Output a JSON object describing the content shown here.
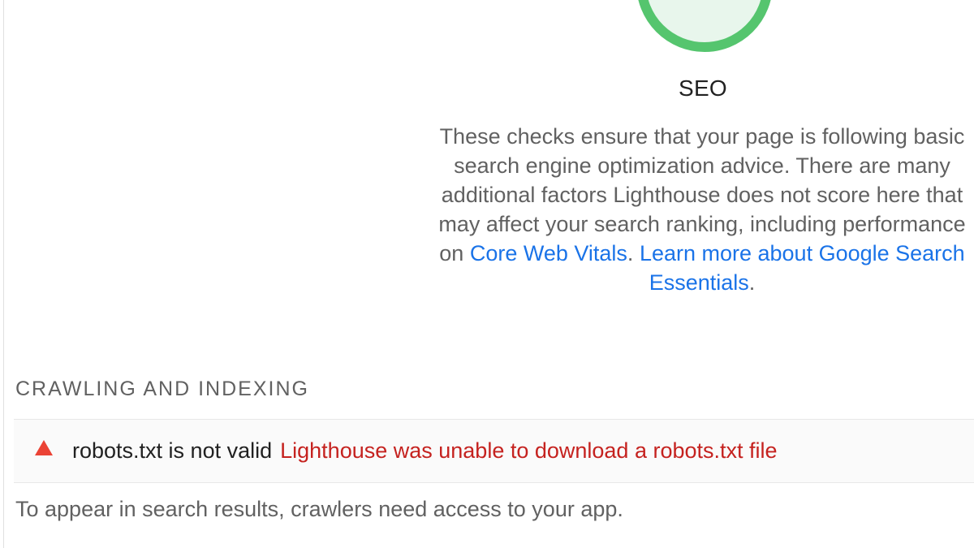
{
  "category": {
    "title": "SEO",
    "score_color": "#0cce6b",
    "score_ring_color": "#55c56e",
    "score_fill_color": "#e8f6ec",
    "description": {
      "line1": "These checks ensure that your page is following basic",
      "line2": "search engine optimization advice. There are many",
      "line3": "additional factors Lighthouse does not score here that",
      "line4": "may affect your search ranking, including performance",
      "line5_prefix": "on ",
      "core_web_vitals_link": "Core Web Vitals",
      "line5_separator": ". ",
      "learn_more_link_part1": "Learn more about Google Search",
      "learn_more_link_part2": "Essentials",
      "line6_suffix": "."
    }
  },
  "group": {
    "heading": "CRAWLING AND INDEXING"
  },
  "audit": {
    "status": "fail",
    "status_icon": "fail-triangle-icon",
    "status_color": "#eb4335",
    "title": "robots.txt is not valid",
    "explanation": "Lighthouse was unable to download a robots.txt file",
    "explanation_color": "#c5221f",
    "description": "To appear in search results, crawlers need access to your app."
  },
  "colors": {
    "link": "#1a73e8",
    "text_secondary": "#616161"
  }
}
